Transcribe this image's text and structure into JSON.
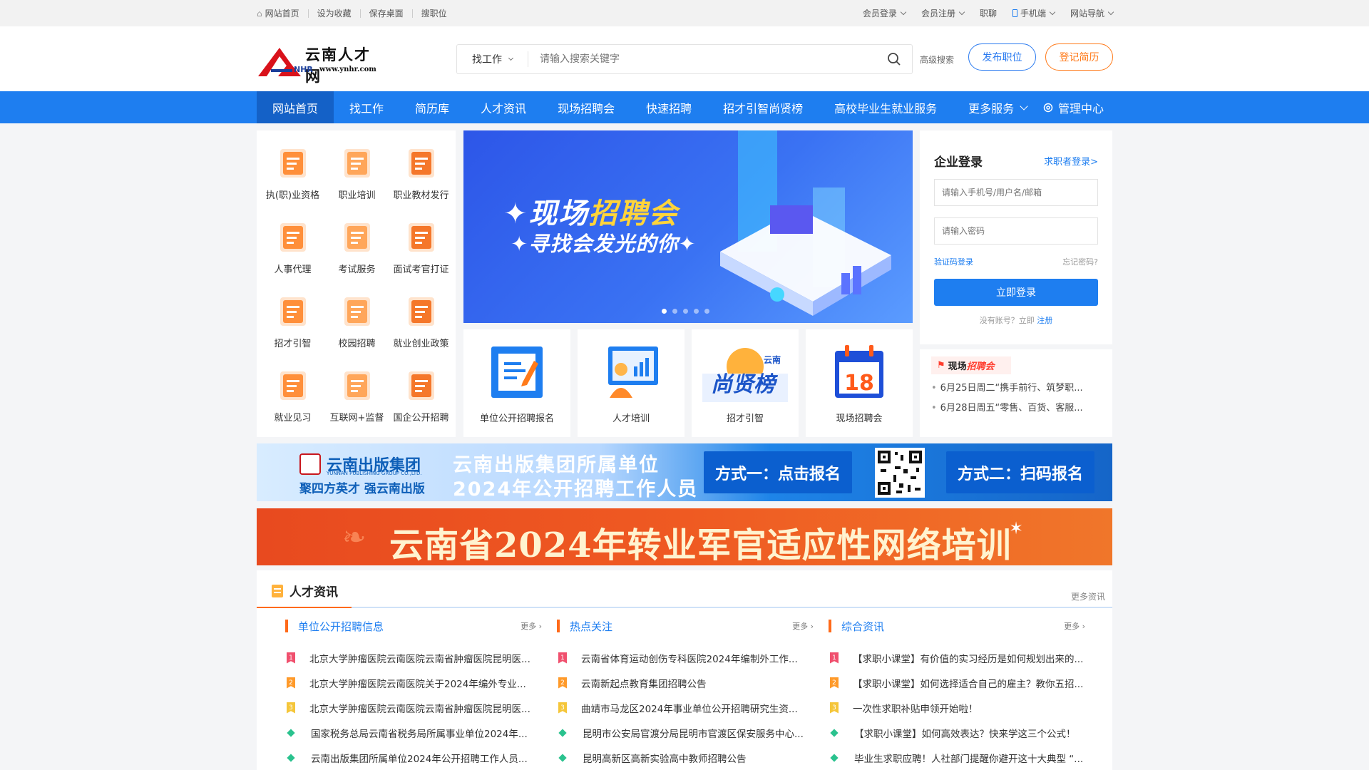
{
  "topbar": {
    "left": [
      "网站首页",
      "设为收藏",
      "保存桌面",
      "搜职位"
    ],
    "right": [
      "会员登录",
      "会员注册",
      "职聊",
      "手机端",
      "网站导航"
    ]
  },
  "logo": {
    "cn": "云南人才网",
    "abbr": "NHR",
    "url": "www.ynhr.com"
  },
  "search": {
    "select": "找工作",
    "placeholder": "请输入搜索关键字",
    "advanced": "高级搜索"
  },
  "header_buttons": {
    "post": "发布职位",
    "resume": "登记简历"
  },
  "nav": {
    "items": [
      "网站首页",
      "找工作",
      "简历库",
      "人才资讯",
      "现场招聘会",
      "快速招聘",
      "招才引智尚贤榜",
      "高校毕业生就业服务",
      "更多服务"
    ],
    "management": "管理中心"
  },
  "services": [
    {
      "label": "执(职)业资格",
      "icon": "certificate-icon"
    },
    {
      "label": "职业培训",
      "icon": "uniform-icon"
    },
    {
      "label": "职业教材发行",
      "icon": "book-icon"
    },
    {
      "label": "人事代理",
      "icon": "person-icon"
    },
    {
      "label": "考试服务",
      "icon": "exam-icon"
    },
    {
      "label": "面试考官打证",
      "icon": "id-card-icon"
    },
    {
      "label": "招才引智",
      "icon": "talent-icon"
    },
    {
      "label": "校园招聘",
      "icon": "graduation-cap-icon"
    },
    {
      "label": "就业创业政策",
      "icon": "policy-icon"
    },
    {
      "label": "就业见习",
      "icon": "intern-icon"
    },
    {
      "label": "互联网+监督",
      "icon": "network-icon"
    },
    {
      "label": "国企公开招聘",
      "icon": "star-icon"
    }
  ],
  "banner": {
    "line1a": "现场",
    "line1b": "招聘会",
    "line2": "寻找会发光的你"
  },
  "tiles": [
    "单位公开招聘报名",
    "人才培训",
    "招才引智",
    "现场招聘会"
  ],
  "tile_texts": {
    "shangxian": "尚贤榜",
    "yunnan": "云南",
    "date": "18"
  },
  "login": {
    "title": "企业登录",
    "switch": "求职者登录>",
    "user_placeholder": "请输入手机号/用户名/邮箱",
    "pass_placeholder": "请输入密码",
    "code_login": "验证码登录",
    "forgot": "忘记密码?",
    "submit": "立即登录",
    "no_account": "没有账号？立即",
    "register": "注册"
  },
  "fair": {
    "tag_a": "现场",
    "tag_b": "招聘会",
    "items": [
      "6月25日周二“携手前行、筑梦职...",
      "6月28日周五“零售、百货、客服..."
    ]
  },
  "ad1": {
    "org": "云南出版集团",
    "org_en": "YUNNAN PUBLISHING GROUP CO.,LTD.",
    "slogan": "聚四方英才 强云南出版",
    "title1": "云南出版集团所属单位",
    "title2": "2024年公开招聘工作人员",
    "method1": "方式一：点击报名",
    "method2": "方式二：扫码报名"
  },
  "ad2": {
    "title": "云南省2024年转业军官适应性网络培训"
  },
  "news": {
    "title": "人才资讯",
    "more": "更多资讯",
    "columns": [
      {
        "title": "单位公开招聘信息",
        "more": "更多",
        "rows": [
          "北京大学肿瘤医院云南医院云南省肿瘤医院昆明医...",
          "北京大学肿瘤医院云南医院关于2024年编外专业...",
          "北京大学肿瘤医院云南医院云南省肿瘤医院昆明医...",
          "国家税务总局云南省税务局所属事业单位2024年...",
          "云南出版集团所属单位2024年公开招聘工作人员..."
        ]
      },
      {
        "title": "热点关注",
        "more": "更多",
        "rows": [
          "云南省体育运动创伤专科医院2024年编制外工作...",
          "云南新起点教育集团招聘公告",
          "曲靖市马龙区2024年事业单位公开招聘研究生资...",
          "昆明市公安局官渡分局昆明市官渡区保安服务中心...",
          "昆明高新区高新实验高中教师招聘公告"
        ]
      },
      {
        "title": "综合资讯",
        "more": "更多",
        "rows": [
          "【求职小课堂】有价值的实习经历是如何规划出来的...",
          "【求职小课堂】如何选择适合自己的雇主？教你五招...",
          "一次性求职补贴申领开始啦！",
          "【求职小课堂】如何高效表达？快来学这三个公式！",
          "毕业生求职应聘！人社部门提醒你避开这十大典型 “..."
        ]
      }
    ]
  },
  "colors": {
    "primary": "#1e7ef0",
    "accent": "#ff6a1a",
    "nav_active": "#1461c7"
  }
}
